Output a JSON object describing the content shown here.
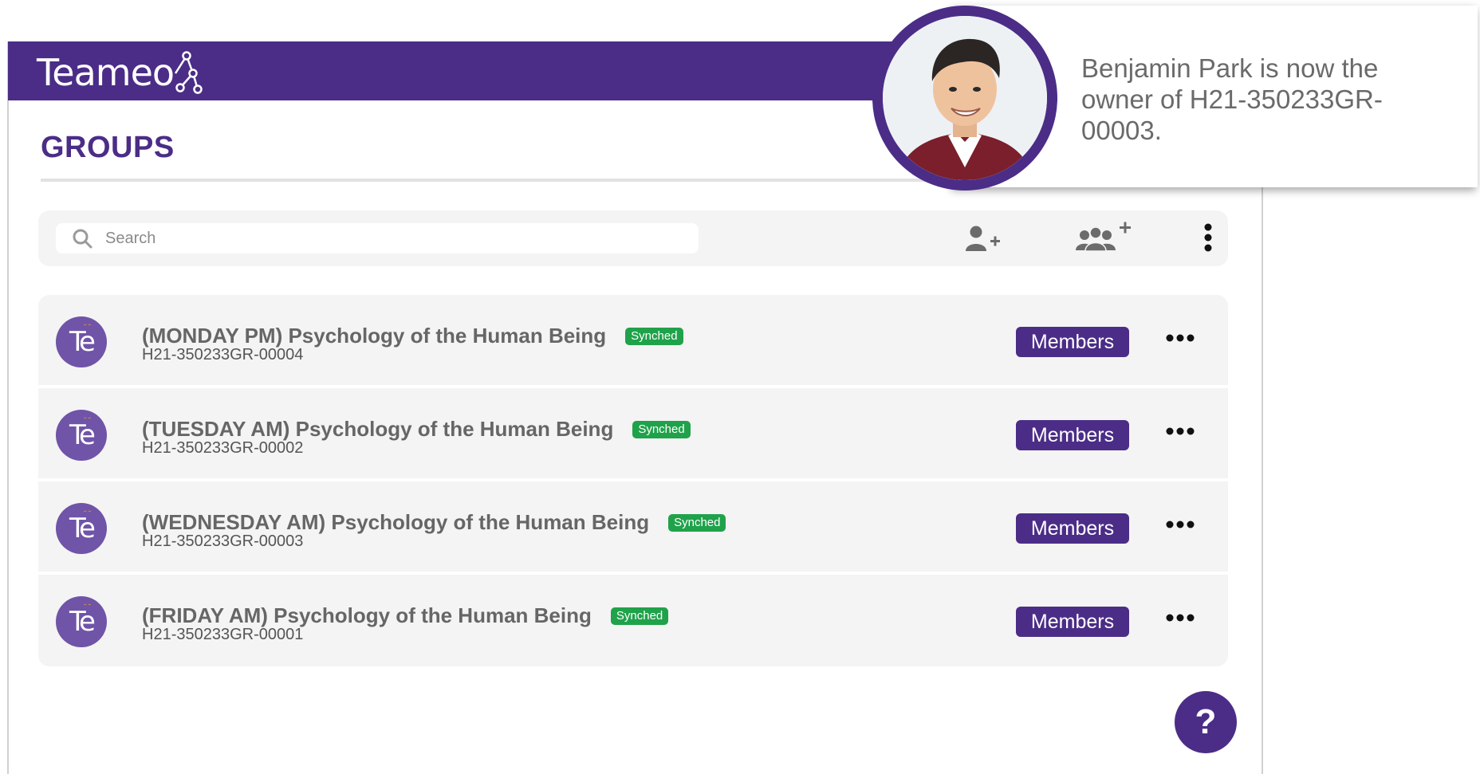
{
  "app": {
    "logo_text": "Teameo"
  },
  "page": {
    "title": "GROUPS"
  },
  "toolbar": {
    "search_placeholder": "Search",
    "add_user_icon": "add-user-icon",
    "add_group_icon": "add-group-icon",
    "menu_icon": "vertical-ellipsis-icon"
  },
  "groups": [
    {
      "avatar_text": "Te",
      "name": "(MONDAY PM) Psychology of the Human Being",
      "status": "Synched",
      "code": "H21-350233GR-00004",
      "members_label": "Members"
    },
    {
      "avatar_text": "Te",
      "name": "(TUESDAY AM) Psychology of the Human Being",
      "status": "Synched",
      "code": "H21-350233GR-00002",
      "members_label": "Members"
    },
    {
      "avatar_text": "Te",
      "name": "(WEDNESDAY AM) Psychology of the Human Being",
      "status": "Synched",
      "code": "H21-350233GR-00003",
      "members_label": "Members"
    },
    {
      "avatar_text": "Te",
      "name": "(FRIDAY AM) Psychology of the Human Being",
      "status": "Synched",
      "code": "H21-350233GR-00001",
      "members_label": "Members"
    }
  ],
  "help": {
    "label": "?"
  },
  "notification": {
    "message": "Benjamin Park is now the owner of H21-350233GR-00003."
  },
  "colors": {
    "brand_purple": "#4b2d87",
    "avatar_purple": "#6f54a8",
    "synched_green": "#1fa24a",
    "row_background": "#f4f4f4"
  }
}
